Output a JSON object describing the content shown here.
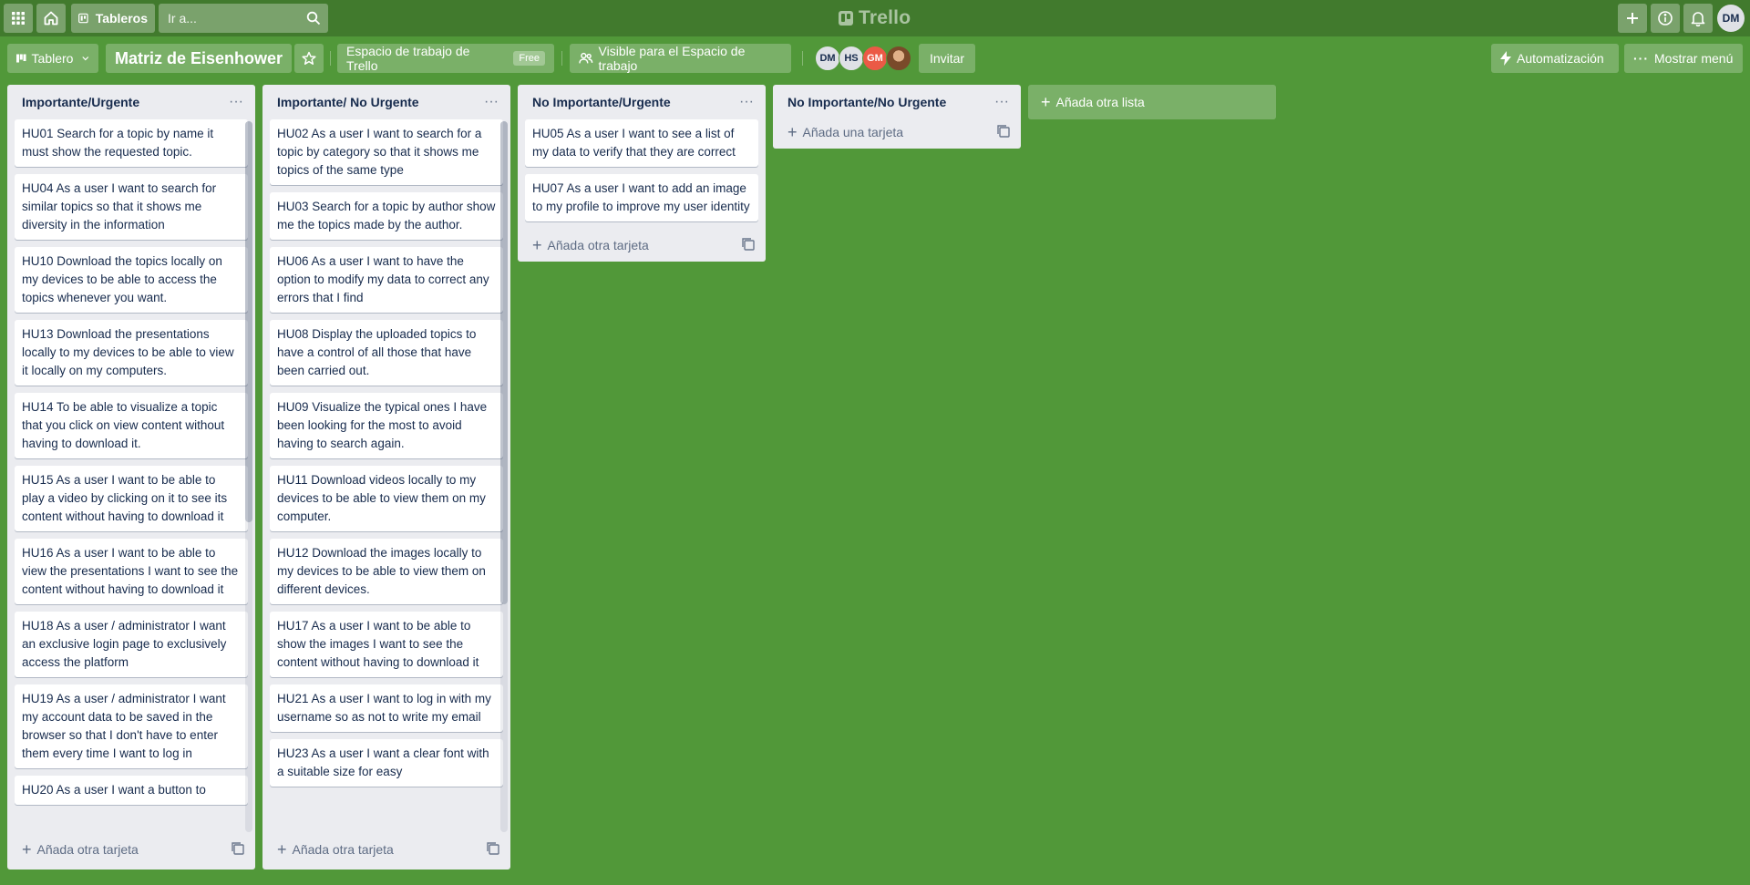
{
  "topbar": {
    "boards_label": "Tableros",
    "search_placeholder": "Ir a...",
    "logo_text": "Trello",
    "user_initials": "DM"
  },
  "board": {
    "view_label": "Tablero",
    "title": "Matriz de Eisenhower",
    "workspace_label": "Espacio de trabajo de Trello",
    "workspace_badge": "Free",
    "visibility_label": "Visible para el Espacio de trabajo",
    "members": [
      {
        "initials": "DM",
        "bg": "#dfe1e6",
        "fg": "#172b4d"
      },
      {
        "initials": "HS",
        "bg": "#dfe1e6",
        "fg": "#172b4d"
      },
      {
        "initials": "GM",
        "bg": "#eb5a46",
        "fg": "#ffffff"
      },
      {
        "initials": "",
        "bg": "#8d5b3c",
        "fg": "#ffffff"
      }
    ],
    "invite_label": "Invitar",
    "automation_label": "Automatización",
    "menu_label": "Mostrar menú"
  },
  "lists": [
    {
      "title": "Importante/Urgente",
      "cards": [
        "HU01 Search for a topic by name it must show the requested topic.",
        "HU04 As a user I want to search for similar topics so that it shows me diversity in the information",
        "HU10 Download the topics locally on my devices to be able to access the topics whenever you want.",
        "HU13 Download the presentations locally to my devices to be able to view it locally on my computers.",
        "HU14 To be able to visualize a topic that you click on view content without having to download it.",
        "HU15 As a user I want to be able to play a video by clicking on it to see its content without having to download it",
        "HU16 As a user I want to be able to view the presentations I want to see the content without having to download it",
        "HU18 As a user / administrator I want an exclusive login page to exclusively access the platform",
        "HU19 As a user / administrator I want my account data to be saved in the browser so that I don't have to enter them every time I want to log in",
        "HU20 As a user I want a button to"
      ],
      "add_label": "Añada otra tarjeta"
    },
    {
      "title": "Importante/ No Urgente",
      "cards": [
        "HU02 As a user I want to search for a topic by category so that it shows me topics of the same type",
        "HU03 Search for a topic by author show me the topics made by the author.",
        "HU06 As a user I want to have the option to modify my data to correct any errors that I find",
        "HU08 Display the uploaded topics to have a control of all those that have been carried out.",
        "HU09 Visualize the typical ones I have been looking for the most to avoid having to search again.",
        "HU11 Download videos locally to my devices to be able to view them on my computer.",
        "HU12 Download the images locally to my devices to be able to view them on different devices.",
        "HU17 As a user I want to be able to show the images I want to see the content without having to download it",
        "HU21 As a user I want to log in with my username so as not to write my email",
        "HU23 As a user I want a clear font with a suitable size for easy"
      ],
      "add_label": "Añada otra tarjeta"
    },
    {
      "title": "No Importante/Urgente",
      "cards": [
        "HU05 As a user I want to see a list of my data to verify that they are correct",
        "HU07 As a user I want to add an image to my profile to improve my user identity"
      ],
      "add_label": "Añada otra tarjeta"
    },
    {
      "title": "No Importante/No Urgente",
      "cards": [],
      "add_label": "Añada una tarjeta"
    }
  ],
  "add_list_label": "Añada otra lista",
  "colors": {
    "background": "#519839",
    "header": "#417a2d",
    "list_bg": "#ebecf0"
  }
}
